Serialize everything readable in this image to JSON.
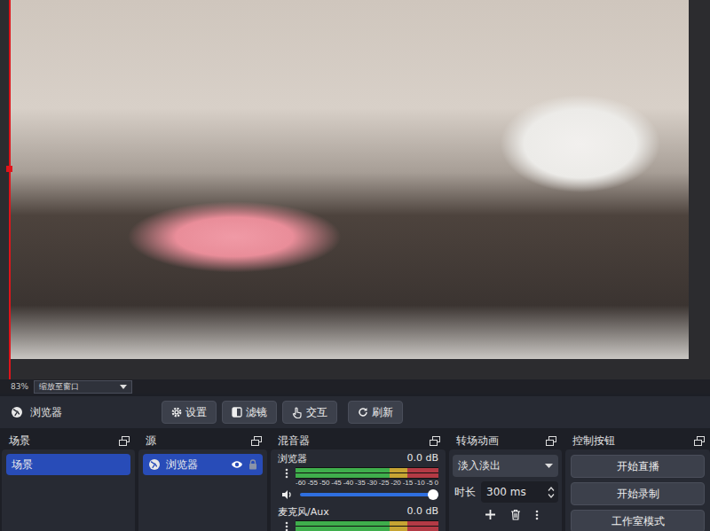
{
  "preview": {
    "zoom": "83%",
    "scale_mode": "缩放至窗口"
  },
  "source_toolbar": {
    "source": "浏览器",
    "buttons": [
      "设置",
      "滤镜",
      "交互",
      "刷新"
    ]
  },
  "scenes": {
    "title": "场景",
    "items": [
      {
        "label": "场景",
        "selected": true
      }
    ]
  },
  "sources": {
    "title": "源",
    "items": [
      {
        "label": "浏览器",
        "selected": true,
        "visible": true,
        "locked": false
      }
    ]
  },
  "mixer": {
    "title": "混音器",
    "scale": [
      "-60",
      "-55",
      "-50",
      "-45",
      "-40",
      "-35",
      "-30",
      "-25",
      "-20",
      "-15",
      "-10",
      "-5",
      "0"
    ],
    "channels": [
      {
        "name": "浏览器",
        "reading": "0.0 dB",
        "level": 0,
        "volume": 1,
        "muted": false
      },
      {
        "name": "麦克风/Aux",
        "reading": "0.0 dB",
        "level": 0,
        "volume": 1,
        "muted": false
      }
    ]
  },
  "transitions": {
    "title": "转场动画",
    "selected": "淡入淡出",
    "duration_label": "时长",
    "duration": "300 ms"
  },
  "controls": {
    "title": "控制按钮",
    "buttons": [
      "开始直播",
      "开始录制",
      "工作室模式"
    ]
  }
}
